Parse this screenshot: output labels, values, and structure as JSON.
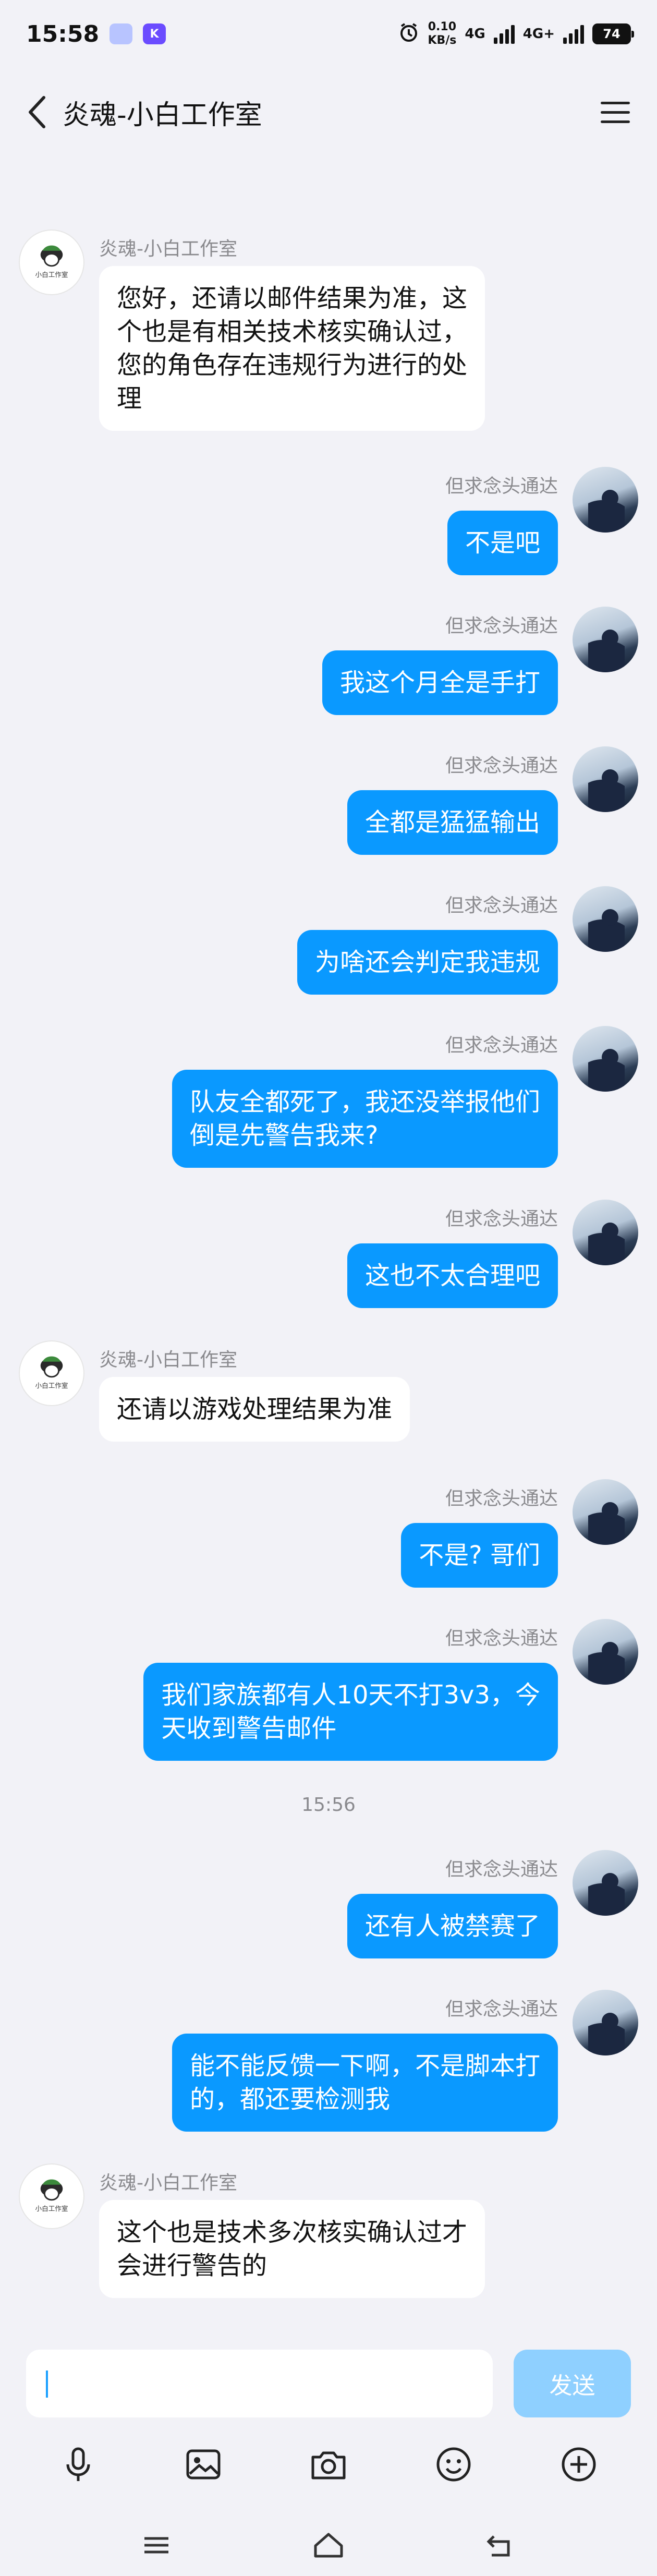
{
  "status": {
    "time": "15:58",
    "badge1": "",
    "badge2": "K",
    "speed_value": "0.10",
    "speed_unit": "KB/s",
    "net1": "4G",
    "net2": "4G+",
    "battery": "74"
  },
  "header": {
    "title": "炎魂-小白工作室"
  },
  "messages": [
    {
      "side": "left",
      "sender": "炎魂-小白工作室",
      "text": "您好，还请以邮件结果为准，这\n个也是有相关技术核实确认过，\n您的角色存在违规行为进行的处\n理"
    },
    {
      "side": "right",
      "sender": "但求念头通达",
      "text": "不是吧"
    },
    {
      "side": "right",
      "sender": "但求念头通达",
      "text": "我这个月全是手打"
    },
    {
      "side": "right",
      "sender": "但求念头通达",
      "text": "全都是猛猛输出"
    },
    {
      "side": "right",
      "sender": "但求念头通达",
      "text": "为啥还会判定我违规"
    },
    {
      "side": "right",
      "sender": "但求念头通达",
      "text": "队友全都死了，我还没举报他们\n倒是先警告我来?"
    },
    {
      "side": "right",
      "sender": "但求念头通达",
      "text": "这也不太合理吧"
    },
    {
      "side": "left",
      "sender": "炎魂-小白工作室",
      "text": "还请以游戏处理结果为准"
    },
    {
      "side": "right",
      "sender": "但求念头通达",
      "text": "不是? 哥们"
    },
    {
      "side": "right",
      "sender": "但求念头通达",
      "text": "我们家族都有人10天不打3v3，今\n天收到警告邮件"
    },
    {
      "side": "right",
      "sender": "但求念头通达",
      "text": "还有人被禁赛了"
    },
    {
      "side": "right",
      "sender": "但求念头通达",
      "text": "能不能反馈一下啊，不是脚本打\n的，都还要检测我"
    },
    {
      "side": "left",
      "sender": "炎魂-小白工作室",
      "text": "这个也是技术多次核实确认过才\n会进行警告的"
    }
  ],
  "time_separator": "15:56",
  "input": {
    "value": "",
    "send_label": "发送"
  },
  "toolbar": [
    "microphone-icon",
    "image-icon",
    "camera-icon",
    "emoji-icon",
    "plus-icon"
  ],
  "colors": {
    "bubble_self": "#0a99ff",
    "bubble_other": "#ffffff",
    "background": "#f2f2f7",
    "send_disabled": "#8fd0ff"
  }
}
